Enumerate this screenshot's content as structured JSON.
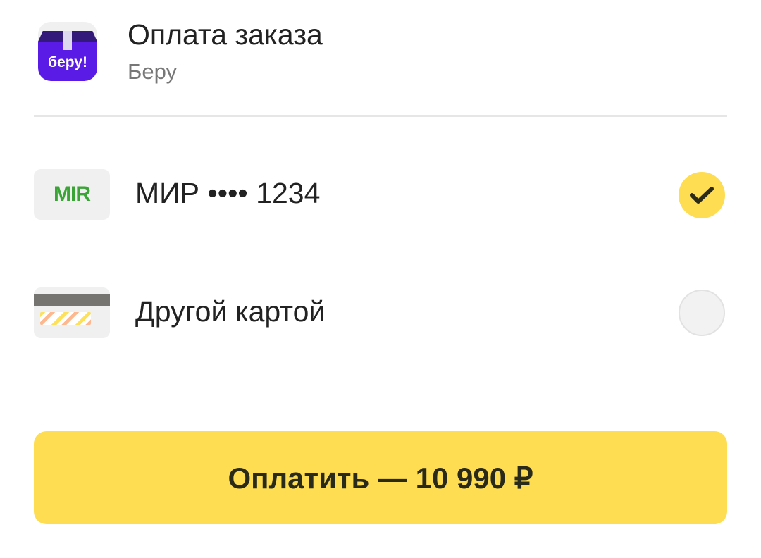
{
  "header": {
    "logo_text": "беру!",
    "title": "Оплата заказа",
    "subtitle": "Беру"
  },
  "methods": [
    {
      "icon": "mir-card-icon",
      "logo_text": "MIR",
      "label": "МИР •••• 1234",
      "selected": true
    },
    {
      "icon": "generic-card-icon",
      "label": "Другой картой",
      "selected": false
    }
  ],
  "pay_button": {
    "label": "Оплатить — 10 990 ₽"
  },
  "colors": {
    "accent": "#fedd53",
    "brand": "#5a1be6",
    "mir": "#3aa536"
  }
}
